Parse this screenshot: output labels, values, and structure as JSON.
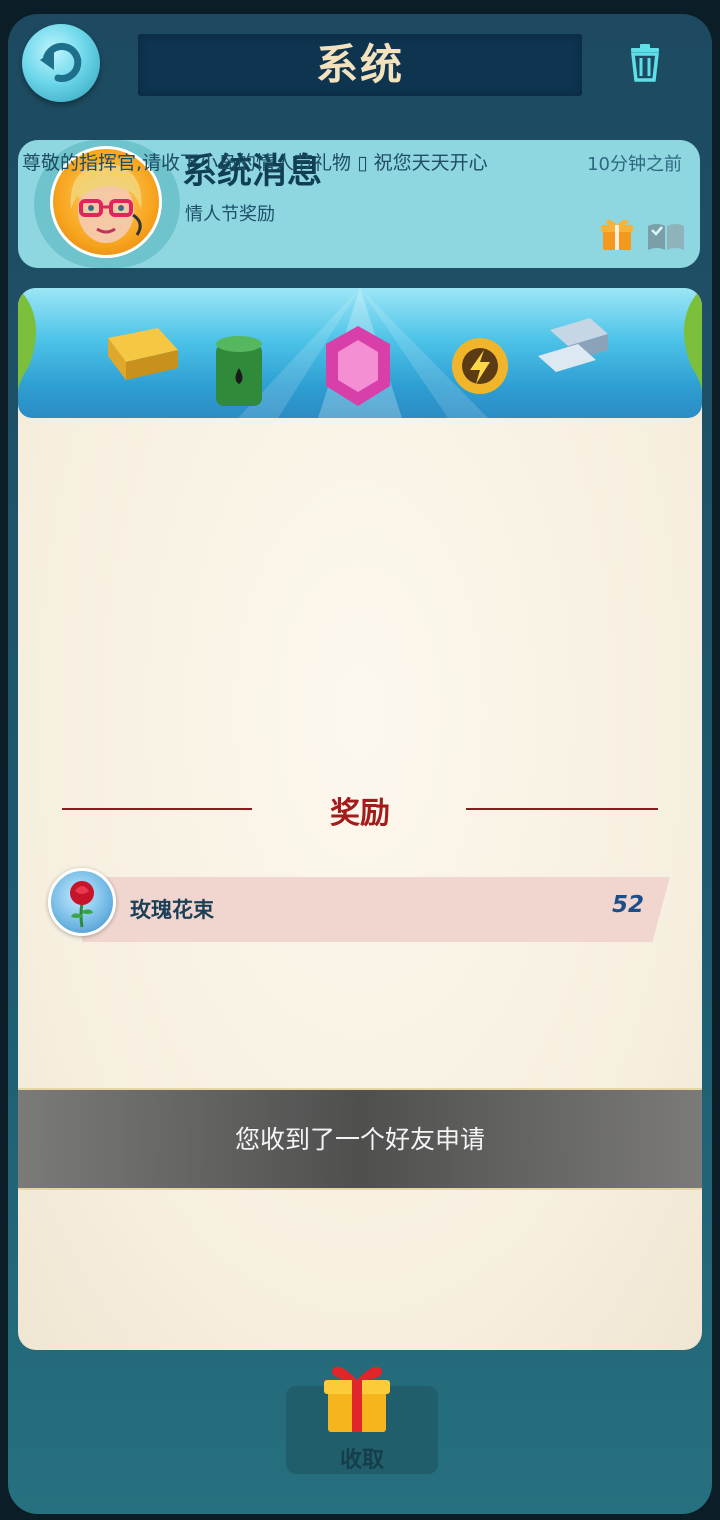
{
  "header": {
    "title": "系统",
    "back_icon": "back-arrow-icon",
    "delete_icon": "trash-icon"
  },
  "message": {
    "sender": "系统消息",
    "subject": "情人节奖励",
    "time": "10分钟之前",
    "attachment_icon": "gift-icon",
    "read_icon": "open-book-icon"
  },
  "body": {
    "banner_icons": [
      "gold-bars-icon",
      "oil-barrel-icon",
      "crystal-gem-icon",
      "power-token-icon",
      "steel-ingots-icon"
    ],
    "text": "尊敬的指挥官,请收下小岛的情人节礼物 ▯ 祝您天天开心"
  },
  "rewards": {
    "heading": "奖励",
    "items": [
      {
        "icon": "rose-bouquet-icon",
        "name": "玫瑰花束",
        "count": "52"
      }
    ]
  },
  "toast": {
    "text": "您收到了一个好友申请"
  },
  "footer": {
    "claim_label": "收取",
    "claim_icon": "gift-box-icon"
  },
  "colors": {
    "frame": "#1f5a70",
    "card": "#8fd7e0",
    "title_text": "#f3e2bc",
    "reward_red": "#a21c1c",
    "paper": "#f6efdf"
  }
}
